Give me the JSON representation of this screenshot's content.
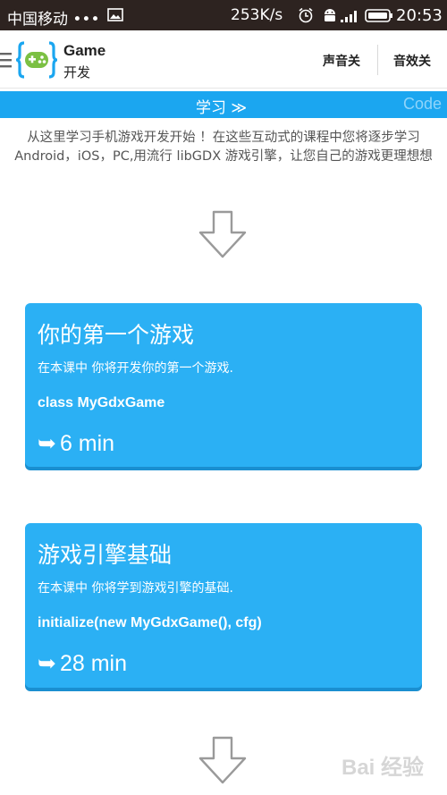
{
  "status_bar": {
    "carrier": "中国移动 •••",
    "speed": "253K/s",
    "time": "20:53",
    "icons": [
      "photo-icon",
      "alarm-icon",
      "android-icon",
      "signal-icon",
      "battery-icon"
    ]
  },
  "header": {
    "title": "Game",
    "subtitle": "开发",
    "sound_label": "声音关",
    "effects_label": "音效关"
  },
  "tabs": {
    "learn": "学习 ≫",
    "code": "Code"
  },
  "intro": "从这里学习手机游戏开发开始 ！在这些互动式的课程中您将逐步学习 Android，iOS，PC,用流行 libGDX 游戏引擎，让您自己的游戏更理想想",
  "lessons": [
    {
      "title": "你的第一个游戏",
      "description": "在本课中 你将开发你的第一个游戏.",
      "code": "class MyGdxGame",
      "duration": "6 min"
    },
    {
      "title": "游戏引擎基础",
      "description": "在本课中 你将学到游戏引擎的基础.",
      "code": "initialize(new MyGdxGame(), cfg)",
      "duration": "28 min"
    }
  ],
  "watermark": "Bai 经验",
  "colors": {
    "status_bar": "#2d2320",
    "accent": "#1ba6f0",
    "card": "#2bb0f4",
    "card_shadow": "#1a8fd0",
    "code_tab": "#8fd4fa"
  }
}
